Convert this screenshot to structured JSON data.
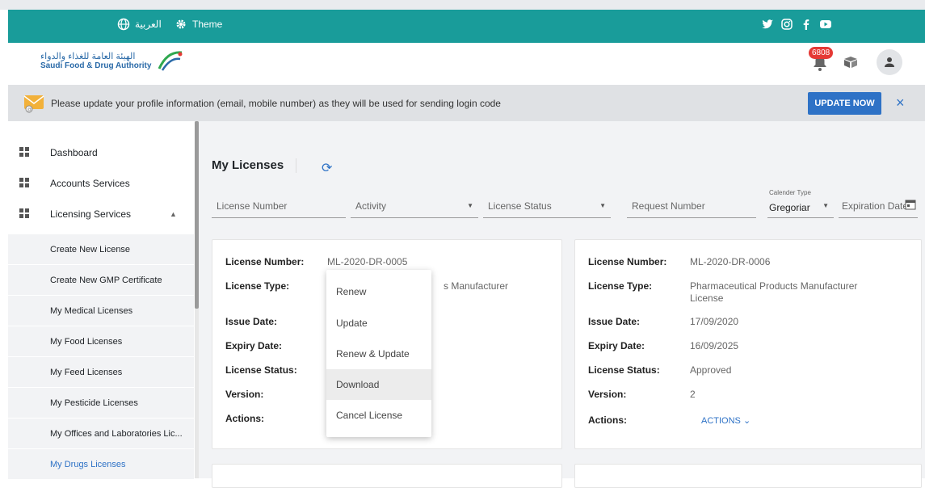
{
  "navbar": {
    "lang_label": "العربية",
    "theme_label": "Theme",
    "social_icons": [
      "twitter-icon",
      "instagram-icon",
      "facebook-icon",
      "youtube-icon"
    ]
  },
  "header": {
    "logo_ar": "الهيئة العامة للغذاء والدواء",
    "logo_en": "Saudi Food & Drug Authority",
    "notification_count": "6808"
  },
  "notice": {
    "message": "Please update your profile information (email, mobile number) as they will be used for sending login code",
    "button": "UPDATE NOW",
    "close": "×"
  },
  "sidebar": {
    "items": [
      {
        "label": "Dashboard"
      },
      {
        "label": "Accounts Services"
      },
      {
        "label": "Licensing Services"
      }
    ],
    "sub_items": [
      {
        "label": "Create New License"
      },
      {
        "label": "Create New GMP Certificate"
      },
      {
        "label": "My Medical Licenses"
      },
      {
        "label": "My Food Licenses"
      },
      {
        "label": "My Feed Licenses"
      },
      {
        "label": "My Pesticide Licenses"
      },
      {
        "label": "My Offices and Laboratories Lic..."
      },
      {
        "label": "My Drugs Licenses"
      }
    ]
  },
  "main": {
    "title": "My Licenses",
    "filters": {
      "license_number": "License Number",
      "activity": "Activity",
      "license_status": "License Status",
      "request_number": "Request Number",
      "calendar_type_label": "Calender Type",
      "calendar_type_value": "Gregoriar",
      "expiration_date": "Expiration Date"
    },
    "field_labels": {
      "license_number": "License Number:",
      "license_type": "License Type:",
      "issue_date": "Issue Date:",
      "expiry_date": "Expiry Date:",
      "license_status": "License Status:",
      "version": "Version:",
      "actions": "Actions:"
    },
    "cards": [
      {
        "license_number": "ML-2020-DR-0005",
        "license_type_tail": "s Manufacturer"
      },
      {
        "license_number": "ML-2020-DR-0006",
        "license_type": "Pharmaceutical Products Manufacturer License",
        "issue_date": "17/09/2020",
        "expiry_date": "16/09/2025",
        "license_status": "Approved",
        "version": "2",
        "actions_label": "ACTIONS ⌄"
      }
    ],
    "actions_menu": [
      {
        "label": "Renew"
      },
      {
        "label": "Update"
      },
      {
        "label": "Renew & Update"
      },
      {
        "label": "Download"
      },
      {
        "label": "Cancel License"
      }
    ]
  }
}
